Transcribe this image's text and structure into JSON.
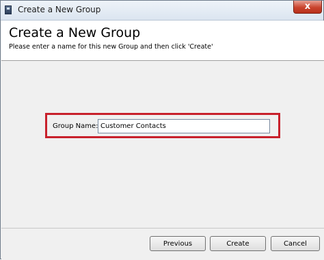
{
  "window": {
    "title": "Create a New Group",
    "close_label": "x"
  },
  "header": {
    "title": "Create a New Group",
    "subtitle": "Please enter a name for this new Group and then click 'Create'"
  },
  "form": {
    "group_name_label": "Group Name:",
    "group_name_value": "Customer Contacts"
  },
  "buttons": {
    "previous": "Previous",
    "create": "Create",
    "cancel": "Cancel"
  },
  "colors": {
    "highlight": "#c8202b",
    "close_button": "#c9442e"
  },
  "icons": {
    "app": "app-window-icon",
    "close": "close-icon"
  }
}
